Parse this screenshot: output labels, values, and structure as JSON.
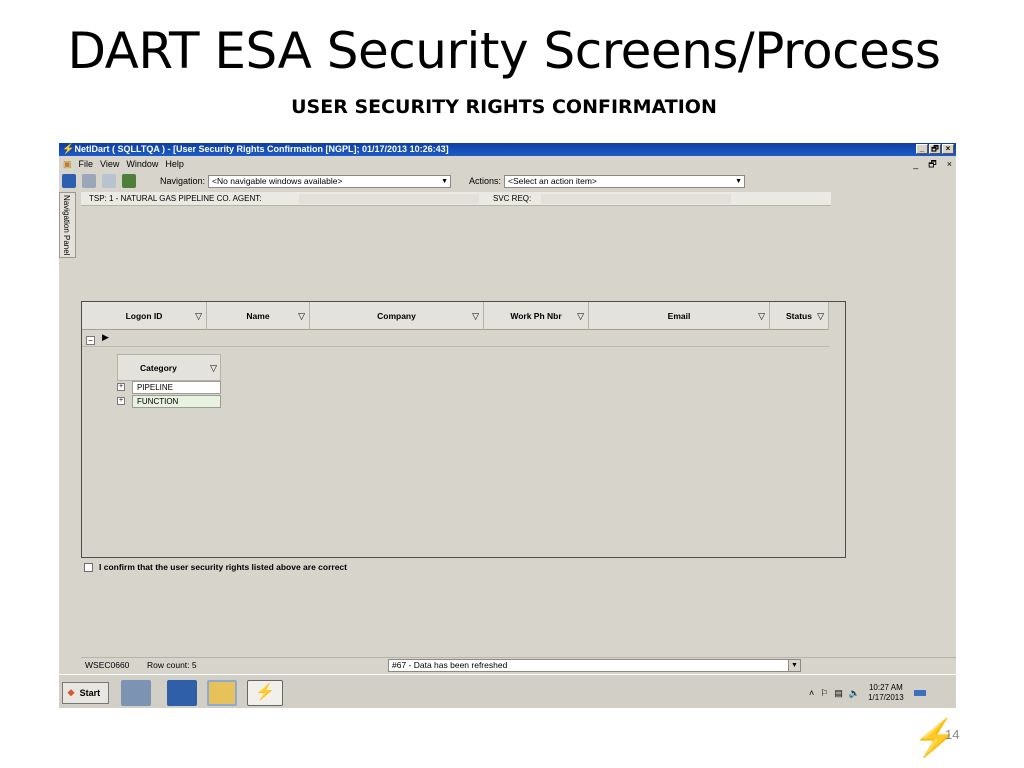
{
  "slide": {
    "title": "DART ESA Security Screens/Process",
    "subtitle": "USER SECURITY RIGHTS CONFIRMATION",
    "page_number": "14"
  },
  "window": {
    "title": "NetIDart ( SQLLTQA ) - [User Security Rights Confirmation [NGPL]; 01/17/2013 10:26:43]",
    "min_label": "_",
    "max_label": "🗗",
    "close_label": "×"
  },
  "menu": {
    "items": [
      "File",
      "View",
      "Window",
      "Help"
    ],
    "mdi_min": "_",
    "mdi_restore": "🗗",
    "mdi_close": "×"
  },
  "toolbar": {
    "navigation_label": "Navigation:",
    "navigation_value": "<No navigable windows available>",
    "actions_label": "Actions:",
    "actions_value": "<Select an action item>"
  },
  "infobar": {
    "tsp": "TSP:  1 - NATURAL GAS PIPELINE CO.   AGENT:",
    "svc_req": "SVC REQ:"
  },
  "nav_panel": {
    "label": "Navigation Panel"
  },
  "grid": {
    "columns": [
      "Logon ID",
      "Name",
      "Company",
      "Work Ph Nbr",
      "Email",
      "Status"
    ],
    "sub_columns": [
      "Category"
    ],
    "sub_rows": [
      "PIPELINE",
      "FUNCTION"
    ]
  },
  "confirm": {
    "label": "I confirm that the user security rights listed above are correct"
  },
  "statusbar": {
    "code": "WSEC0660",
    "row_count": "Row count: 5",
    "message": "#67 - Data has been refreshed"
  },
  "taskbar": {
    "start_label": "Start",
    "time": "10:27 AM",
    "date": "1/17/2013"
  }
}
